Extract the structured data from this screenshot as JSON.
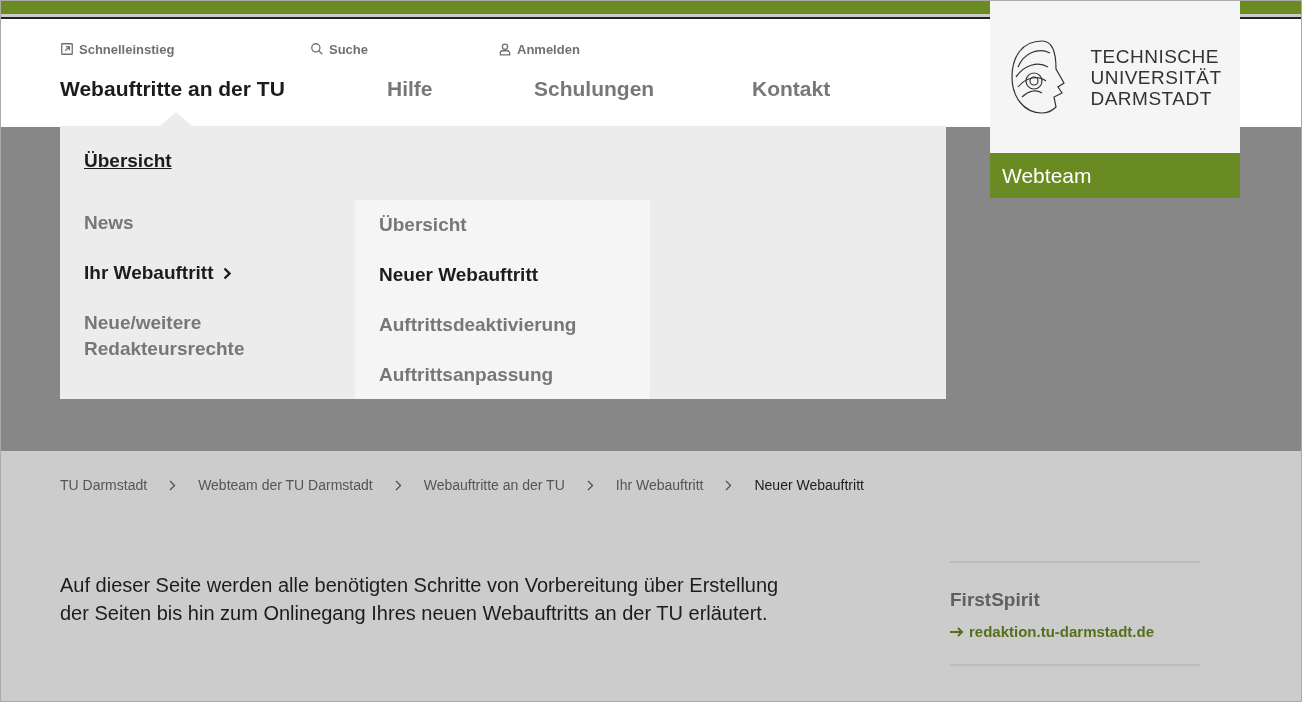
{
  "utility_links": [
    {
      "kind": "external",
      "label": "Schnelleinstieg"
    },
    {
      "kind": "search",
      "label": "Suche"
    },
    {
      "kind": "user",
      "label": "Anmelden"
    }
  ],
  "main_nav": [
    {
      "label": "Webauftritte an der TU",
      "selected": true
    },
    {
      "label": "Hilfe",
      "selected": false
    },
    {
      "label": "Schulungen",
      "selected": false
    },
    {
      "label": "Kontakt",
      "selected": false
    }
  ],
  "logo": {
    "lines": [
      "TECHNISCHE",
      "UNIVERSITÄT",
      "DARMSTADT"
    ],
    "site_name": "Webteam"
  },
  "dropdown": {
    "overview": "Übersicht",
    "items": [
      {
        "label": "News",
        "selected": false,
        "expanded": false
      },
      {
        "label": "Ihr Webauftritt",
        "selected": true,
        "expanded": true
      },
      {
        "label": "Neue/weitere Redakteursrechte",
        "selected": false,
        "expanded": false
      }
    ],
    "submenu": [
      {
        "label": "Übersicht",
        "selected": false
      },
      {
        "label": "Neuer Webauftritt",
        "selected": true
      },
      {
        "label": "Auftrittsdeaktivierung",
        "selected": false
      },
      {
        "label": "Auftrittsanpassung",
        "selected": false
      }
    ]
  },
  "breadcrumb": [
    {
      "label": "TU Darmstadt",
      "selected": false
    },
    {
      "label": "Webteam der TU Darmstadt",
      "selected": false
    },
    {
      "label": "Webauftritte an der TU",
      "selected": false
    },
    {
      "label": "Ihr Webauftritt",
      "selected": false
    },
    {
      "label": "Neuer Webauftritt",
      "selected": true
    }
  ],
  "intro": "Auf dieser Seite werden alle benötigten Schritte von Vorbereitung über Erstellung der Seiten bis hin zum Onlinegang Ihres neuen Webauftritts an der TU erläutert.",
  "sidebar": {
    "title": "FirstSpirit",
    "link": "redaktion.tu-darmstadt.de"
  }
}
